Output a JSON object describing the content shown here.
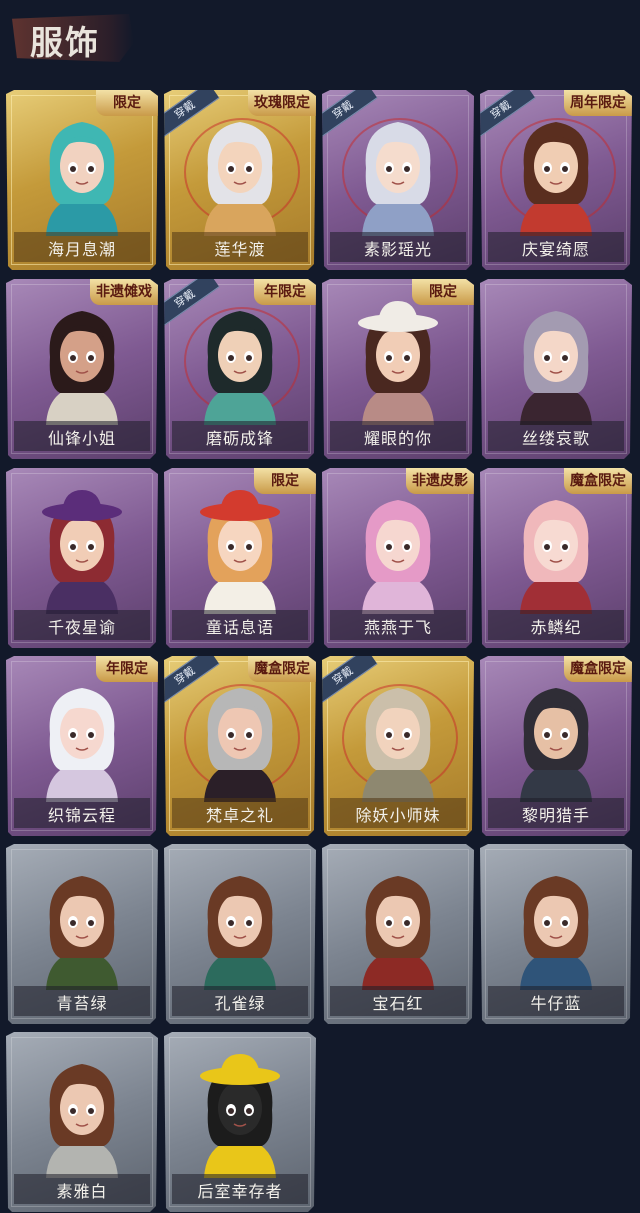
{
  "header": {
    "title": "服饰"
  },
  "cards": [
    {
      "label": "海月息潮",
      "frame": "gold",
      "badge": "限定",
      "equipped": false,
      "hair": "#3fb7b3",
      "skin": "#f1d2c0",
      "outfit": "#2b9aa6",
      "hat": null
    },
    {
      "label": "莲华渡",
      "frame": "gold",
      "badge": "玫瑰限定",
      "equipped": true,
      "hair": "#e3e3e8",
      "skin": "#f3d4bc",
      "outfit": "#d9a55d",
      "hat": null
    },
    {
      "label": "素影瑶光",
      "frame": "purple",
      "badge": "",
      "equipped": true,
      "hair": "#d8dbe7",
      "skin": "#f5dccd",
      "outfit": "#8fa0c6",
      "hat": null
    },
    {
      "label": "庆宴绮愿",
      "frame": "purple",
      "badge": "周年限定",
      "equipped": true,
      "hair": "#5a2e1f",
      "skin": "#f0cdb3",
      "outfit": "#c23a2f",
      "hat": null
    },
    {
      "label": "仙锋小姐",
      "frame": "purple",
      "badge": "非遗傩戏",
      "equipped": false,
      "hair": "#2b1a1a",
      "skin": "#d4a088",
      "outfit": "#d8d1c4",
      "hat": null
    },
    {
      "label": "磨砺成锋",
      "frame": "purple",
      "badge": "年限定",
      "equipped": true,
      "hair": "#1e2a2b",
      "skin": "#efd0b7",
      "outfit": "#4ea497",
      "hat": null
    },
    {
      "label": "耀眼的你",
      "frame": "purple",
      "badge": "限定",
      "equipped": false,
      "hair": "#4a2820",
      "skin": "#f1cdb6",
      "outfit": "#b88b86",
      "hat": "#f0ece6"
    },
    {
      "label": "丝缕哀歌",
      "frame": "purple",
      "badge": "",
      "equipped": false,
      "hair": "#a39bb1",
      "skin": "#f4d7c8",
      "outfit": "#3a2530",
      "hat": null
    },
    {
      "label": "千夜星谕",
      "frame": "purple",
      "badge": "",
      "equipped": false,
      "hair": "#8d2b32",
      "skin": "#f1cdb6",
      "outfit": "#4a2f63",
      "hat": "#5b2d7a"
    },
    {
      "label": "童话息语",
      "frame": "purple",
      "badge": "限定",
      "equipped": false,
      "hair": "#e3a25b",
      "skin": "#f6d6c0",
      "outfit": "#f3efe6",
      "hat": "#d33b2e"
    },
    {
      "label": "燕燕于飞",
      "frame": "purple",
      "badge": "非遗皮影",
      "equipped": false,
      "hair": "#e59ac7",
      "skin": "#f6d7d0",
      "outfit": "#e0b5d9",
      "hat": null
    },
    {
      "label": "赤鳞纪",
      "frame": "purple",
      "badge": "魔盒限定",
      "equipped": false,
      "hair": "#f0b8bb",
      "skin": "#f7dad2",
      "outfit": "#a12f36",
      "hat": null
    },
    {
      "label": "织锦云程",
      "frame": "purple",
      "badge": "年限定",
      "equipped": false,
      "hair": "#eef0f5",
      "skin": "#f6d8cf",
      "outfit": "#d5c7df",
      "hat": null
    },
    {
      "label": "梵卓之礼",
      "frame": "gold",
      "badge": "魔盒限定",
      "equipped": true,
      "hair": "#b7b7b7",
      "skin": "#eec7b3",
      "outfit": "#2b1f28",
      "hat": null
    },
    {
      "label": "除妖小师妹",
      "frame": "gold",
      "badge": "",
      "equipped": true,
      "hair": "#cbbfaa",
      "skin": "#f1d3bd",
      "outfit": "#8e8870",
      "hat": null
    },
    {
      "label": "黎明猎手",
      "frame": "purple",
      "badge": "魔盒限定",
      "equipped": false,
      "hair": "#2f2d36",
      "skin": "#e6c0a5",
      "outfit": "#333946",
      "hat": null
    },
    {
      "label": "青苔绿",
      "frame": "gray",
      "badge": "",
      "equipped": false,
      "hair": "#6a3a25",
      "skin": "#ecc8b2",
      "outfit": "#3f5a30",
      "hat": null
    },
    {
      "label": "孔雀绿",
      "frame": "gray",
      "badge": "",
      "equipped": false,
      "hair": "#6a3a25",
      "skin": "#ecc8b2",
      "outfit": "#2c6b5d",
      "hat": null
    },
    {
      "label": "宝石红",
      "frame": "gray",
      "badge": "",
      "equipped": false,
      "hair": "#6a3a25",
      "skin": "#ecc8b2",
      "outfit": "#8d2a25",
      "hat": null
    },
    {
      "label": "牛仔蓝",
      "frame": "gray",
      "badge": "",
      "equipped": false,
      "hair": "#6a3a25",
      "skin": "#ecc8b2",
      "outfit": "#2f5479",
      "hat": null
    },
    {
      "label": "素雅白",
      "frame": "gray",
      "badge": "",
      "equipped": false,
      "hair": "#6a3a25",
      "skin": "#ecc8b2",
      "outfit": "#b3b4b0",
      "hat": null
    },
    {
      "label": "后室幸存者",
      "frame": "gray",
      "badge": "",
      "equipped": false,
      "hair": "#1c1c1c",
      "skin": "#2a2a2a",
      "outfit": "#e9c619",
      "hat": "#e9c619"
    }
  ],
  "equip_label": "穿戴"
}
